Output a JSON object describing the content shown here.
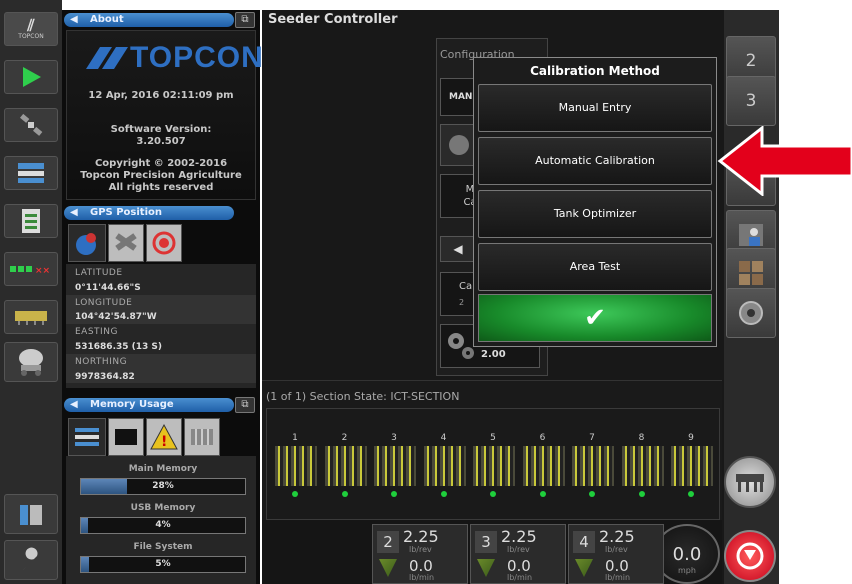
{
  "app": {
    "title": "Seeder Controller"
  },
  "about": {
    "header": "About",
    "logo_text": "TOPCON",
    "datetime": "12 Apr, 2016  02:11:09 pm",
    "software_label": "Software Version:",
    "software_version": "3.20.507",
    "copyright": "Copyright © 2002-2016",
    "company": "Topcon Precision Agriculture",
    "rights": "All rights reserved"
  },
  "gps": {
    "header": "GPS Position",
    "latitude_label": "LATITUDE",
    "latitude": "0°11'44.66\"S",
    "longitude_label": "LONGITUDE",
    "longitude": "104°42'54.87\"W",
    "easting_label": "EASTING",
    "easting": "531686.35 (13 S)",
    "northing_label": "NORTHING",
    "northing": "9978364.82"
  },
  "memory": {
    "header": "Memory Usage",
    "main_label": "Main Memory",
    "main_value": "28%",
    "main_pct": 28,
    "usb_label": "USB Memory",
    "usb_value": "4%",
    "usb_pct": 4,
    "fs_label": "File System",
    "fs_value": "5%",
    "fs_pct": 5
  },
  "left_toolbar": {
    "logo": "TOPCON"
  },
  "config": {
    "label": "Configuration",
    "man_text": "MAN",
    "m_text": "M",
    "ca_text": "Ca",
    "ca2_text": "Ca",
    "two_text": "2",
    "value": "2.00"
  },
  "dialog": {
    "title": "Calibration Method",
    "options": [
      "Manual Entry",
      "Automatic Calibration",
      "Tank Optimizer",
      "Area Test"
    ],
    "ok_label": "✔"
  },
  "section": {
    "title": "(1 of 1) Section State: ICT-SECTION",
    "rows": [
      "1",
      "2",
      "3",
      "4",
      "5",
      "6",
      "7",
      "8",
      "9"
    ]
  },
  "right_toolbar": {
    "btn1": "2",
    "btn2": "3"
  },
  "rates": [
    {
      "num": "2",
      "value": "2.25",
      "unit": "lb/rev",
      "rate": "0.0",
      "rate_unit": "lb/min"
    },
    {
      "num": "3",
      "value": "2.25",
      "unit": "lb/rev",
      "rate": "0.0",
      "rate_unit": "lb/min"
    },
    {
      "num": "4",
      "value": "2.25",
      "unit": "lb/rev",
      "rate": "0.0",
      "rate_unit": "lb/min"
    }
  ],
  "speed": {
    "value": "0.0",
    "unit": "mph"
  },
  "colors": {
    "accent_blue": "#2f74c0",
    "ok_green": "#1fa83a",
    "arrow_red": "#e3001b",
    "active_led": "#1fcf3c"
  }
}
